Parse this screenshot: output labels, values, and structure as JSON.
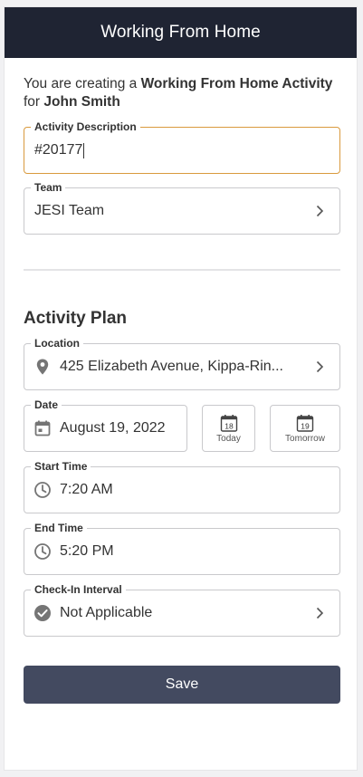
{
  "header": {
    "title": "Working From Home"
  },
  "intro": {
    "prefix": "You are creating a ",
    "activity_type": "Working From Home Activity",
    "for_text": "for ",
    "person": "John Smith"
  },
  "activity_description": {
    "label": "Activity Description",
    "value": "#20177"
  },
  "team": {
    "label": "Team",
    "value": "JESI Team"
  },
  "activity_plan": {
    "title": "Activity Plan",
    "location": {
      "label": "Location",
      "value": "425 Elizabeth Avenue, Kippa-Rin..."
    },
    "date": {
      "label": "Date",
      "value": "August 19, 2022",
      "today_day": "18",
      "today_label": "Today",
      "tomorrow_day": "19",
      "tomorrow_label": "Tomorrow"
    },
    "start_time": {
      "label": "Start Time",
      "value": "7:20 AM"
    },
    "end_time": {
      "label": "End Time",
      "value": "5:20 PM"
    },
    "checkin": {
      "label": "Check-In Interval",
      "value": "Not Applicable"
    }
  },
  "save_label": "Save",
  "colors": {
    "header_bg": "#1f2433",
    "button_bg": "#434a60",
    "active_border": "#d99a3e"
  }
}
